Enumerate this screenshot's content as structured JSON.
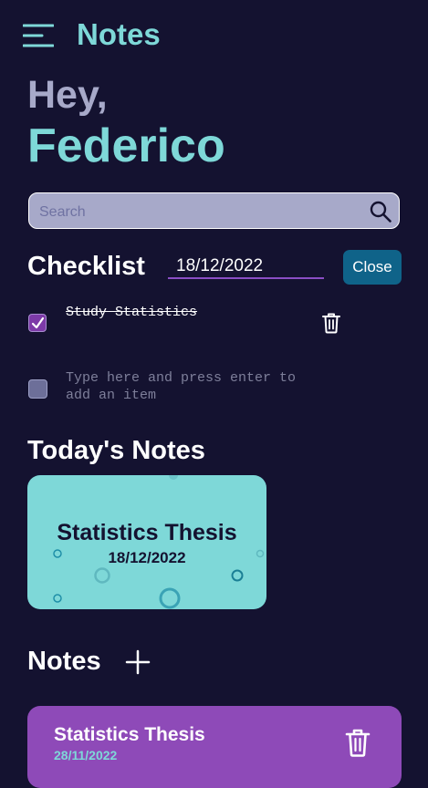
{
  "header": {
    "title": "Notes",
    "menu_icon": "hamburger-menu-icon"
  },
  "greeting": {
    "hey": "Hey,",
    "name": "Federico"
  },
  "search": {
    "placeholder": "Search",
    "value": "",
    "icon": "search-icon"
  },
  "checklist": {
    "title": "Checklist",
    "date_value": "18/12/2022",
    "close_label": "Close",
    "items": [
      {
        "text": "Study Statistics",
        "checked": true
      }
    ],
    "new_item_placeholder": "Type here and press enter to add an item"
  },
  "today_notes": {
    "title": "Today's Notes",
    "cards": [
      {
        "title": "Statistics Thesis",
        "date": "18/12/2022"
      }
    ]
  },
  "notes": {
    "title": "Notes",
    "add_icon": "plus-icon",
    "cards": [
      {
        "title": "Statistics Thesis",
        "date": "28/11/2022"
      }
    ]
  },
  "colors": {
    "background": "#141230",
    "accent_teal": "#7ed8d8",
    "muted_lavender": "#a7a9c9",
    "purple": "#8e4ab8",
    "button_blue": "#0f6389"
  }
}
